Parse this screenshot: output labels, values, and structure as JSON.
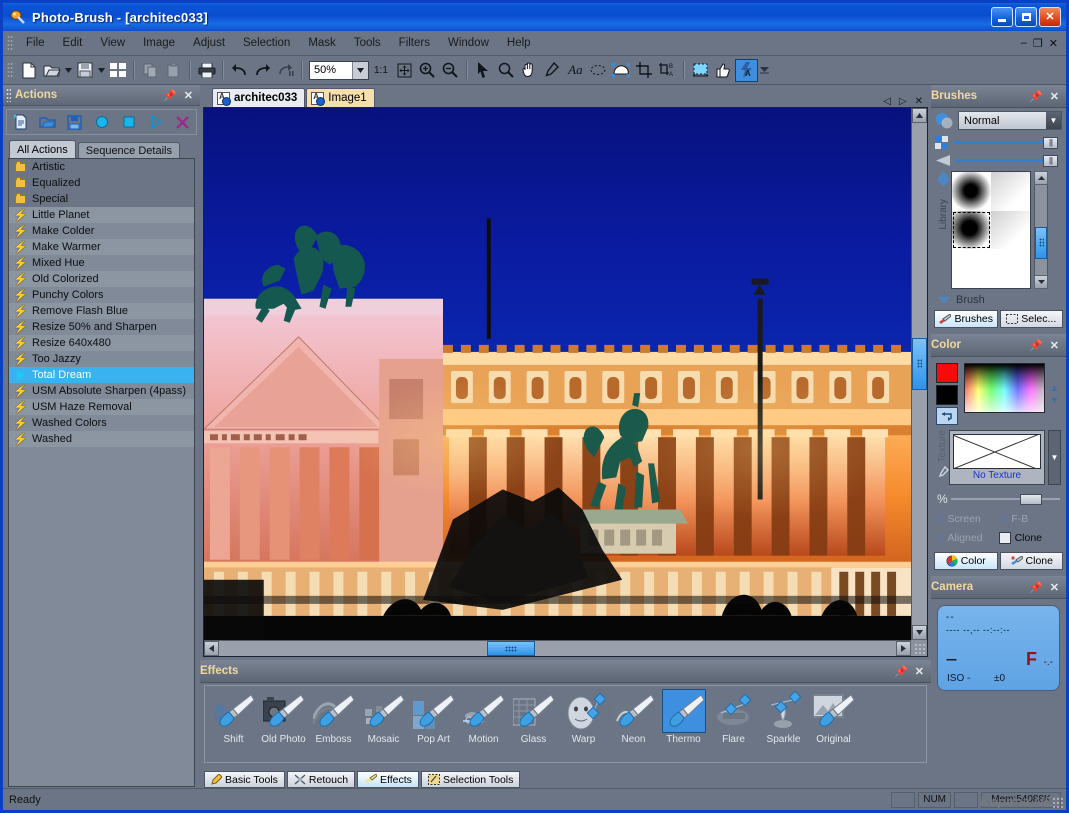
{
  "window": {
    "title": "Photo-Brush - [architec033]",
    "app_icon": "photo-brush-icon",
    "minimize": "minimize-icon",
    "maximize": "maximize-icon",
    "close": "close-icon"
  },
  "menu": {
    "items": [
      "File",
      "Edit",
      "View",
      "Image",
      "Adjust",
      "Selection",
      "Mask",
      "Tools",
      "Filters",
      "Window",
      "Help"
    ],
    "mdi": [
      "minimize-child",
      "restore-child",
      "close-child"
    ]
  },
  "toolbar": {
    "zoom_value": "50%",
    "ratio_label": "1:1",
    "icons": [
      "new-document-icon",
      "open-folder-icon",
      "open-dropdown-icon",
      "save-disk-icon",
      "save-dropdown-icon",
      "thumbnails-icon",
      "copy-icon",
      "paste-icon",
      "print-icon",
      "undo-icon",
      "redo-icon",
      "redo-pause-icon",
      "fit-screen-icon",
      "zoom-in-icon",
      "zoom-out-icon",
      "arrow-pointer-icon",
      "magnifier-icon",
      "hand-pan-icon",
      "eyedropper-icon",
      "text-tool-icon",
      "lasso-select-icon",
      "freehand-mask-icon",
      "crop-icon",
      "perspective-crop-icon",
      "transparency-icon",
      "thumbs-up-icon",
      "auto-enhance-icon"
    ],
    "selected_icon": "auto-enhance-icon",
    "overflow": "toolbar-overflow-icon"
  },
  "actions_panel": {
    "title": "Actions",
    "pin": "pin-icon",
    "close": "close-icon",
    "tool_icons": [
      "new-action-icon",
      "open-action-icon",
      "save-action-icon",
      "record-icon",
      "stop-icon",
      "play-icon",
      "delete-action-icon"
    ],
    "tabs": [
      {
        "label": "All Actions",
        "active": true
      },
      {
        "label": "Sequence Details",
        "active": false
      }
    ],
    "items": [
      {
        "label": "Artistic",
        "type": "folder",
        "selected": false
      },
      {
        "label": "Equalized",
        "type": "folder",
        "selected": false
      },
      {
        "label": "Special",
        "type": "folder",
        "selected": false
      },
      {
        "label": "Little Planet",
        "type": "action",
        "selected": false
      },
      {
        "label": "Make Colder",
        "type": "action",
        "selected": false
      },
      {
        "label": "Make Warmer",
        "type": "action",
        "selected": false
      },
      {
        "label": "Mixed Hue",
        "type": "action",
        "selected": false
      },
      {
        "label": "Old Colorized",
        "type": "action",
        "selected": false
      },
      {
        "label": "Punchy Colors",
        "type": "action",
        "selected": false
      },
      {
        "label": "Remove Flash Blue",
        "type": "action",
        "selected": false
      },
      {
        "label": "Resize 50% and Sharpen",
        "type": "action",
        "selected": false
      },
      {
        "label": "Resize 640x480",
        "type": "action",
        "selected": false
      },
      {
        "label": "Too Jazzy",
        "type": "action",
        "selected": false
      },
      {
        "label": "Total Dream",
        "type": "action",
        "selected": true
      },
      {
        "label": "USM Absolute Sharpen (4pass)",
        "type": "action",
        "selected": false
      },
      {
        "label": "USM Haze Removal",
        "type": "action",
        "selected": false
      },
      {
        "label": "Washed Colors",
        "type": "action",
        "selected": false
      },
      {
        "label": "Washed",
        "type": "action",
        "selected": false
      }
    ]
  },
  "documents": {
    "tabs": [
      {
        "label": "architec033",
        "active": true
      },
      {
        "label": "Image1",
        "active": false
      }
    ],
    "nav": [
      "prev-doc-icon",
      "next-doc-icon",
      "close-doc-icon"
    ]
  },
  "canvas": {
    "image_alt": "Vittoriano monument at night, Rome",
    "vscroll": "vertical-scrollbar",
    "hscroll": "horizontal-scrollbar"
  },
  "brushes_panel": {
    "title": "Brushes",
    "pin": "pin-icon",
    "close": "close-icon",
    "blend_mode": "Normal",
    "library_label": "Library",
    "brush_label": "Brush",
    "tabs": [
      {
        "label": "Brushes",
        "active": true,
        "icon": "brush-icon"
      },
      {
        "label": "Selec...",
        "active": false,
        "icon": "selection-icon"
      }
    ]
  },
  "color_panel": {
    "title": "Color",
    "pin": "pin-icon",
    "close": "close-icon",
    "foreground": "#f40c0c",
    "background": "#000000",
    "texture_label": "Texture",
    "texture_value": "No Texture",
    "percent_label": "%",
    "checks": [
      {
        "label": "Screen",
        "checked": false
      },
      {
        "label": "F-B",
        "checked": false
      },
      {
        "label": "Aligned",
        "checked": false
      },
      {
        "label": "Clone",
        "checked": false
      }
    ],
    "tabs": [
      {
        "label": "Color",
        "active": true,
        "icon": "color-wheel-icon"
      },
      {
        "label": "Clone",
        "active": false,
        "icon": "clone-brush-icon"
      }
    ]
  },
  "camera_panel": {
    "title": "Camera",
    "pin": "pin-icon",
    "close": "close-icon",
    "lcd": {
      "line1": "--",
      "line2": "---- --,-- --:--:--",
      "shutter": "---",
      "f_label": "F",
      "f_value": "-.-",
      "iso": "ISO -",
      "ev": "±0"
    }
  },
  "effects_panel": {
    "title": "Effects",
    "items": [
      {
        "label": "Shift",
        "icon": "shift-effect-icon",
        "selected": false
      },
      {
        "label": "Old Photo",
        "icon": "old-photo-effect-icon",
        "selected": false
      },
      {
        "label": "Emboss",
        "icon": "emboss-effect-icon",
        "selected": false
      },
      {
        "label": "Mosaic",
        "icon": "mosaic-effect-icon",
        "selected": false
      },
      {
        "label": "Pop Art",
        "icon": "pop-art-effect-icon",
        "selected": false
      },
      {
        "label": "Motion",
        "icon": "motion-effect-icon",
        "selected": false
      },
      {
        "label": "Glass",
        "icon": "glass-effect-icon",
        "selected": false
      },
      {
        "label": "Warp",
        "icon": "warp-effect-icon",
        "selected": false
      },
      {
        "label": "Neon",
        "icon": "neon-effect-icon",
        "selected": false
      },
      {
        "label": "Thermo",
        "icon": "thermo-effect-icon",
        "selected": true
      },
      {
        "label": "Flare",
        "icon": "flare-effect-icon",
        "selected": false
      },
      {
        "label": "Sparkle",
        "icon": "sparkle-effect-icon",
        "selected": false
      },
      {
        "label": "Original",
        "icon": "original-effect-icon",
        "selected": false
      }
    ],
    "tabs": [
      {
        "label": "Basic Tools",
        "icon": "pencil-icon",
        "active": false
      },
      {
        "label": "Retouch",
        "icon": "retouch-icon",
        "active": false
      },
      {
        "label": "Effects",
        "icon": "effects-brush-icon",
        "active": true
      },
      {
        "label": "Selection Tools",
        "icon": "selection-tools-icon",
        "active": false
      }
    ]
  },
  "statusbar": {
    "message": "Ready",
    "cells": [
      "",
      "NUM",
      "",
      "Mem:54088K"
    ],
    "watermark": "Kopona.NET"
  }
}
